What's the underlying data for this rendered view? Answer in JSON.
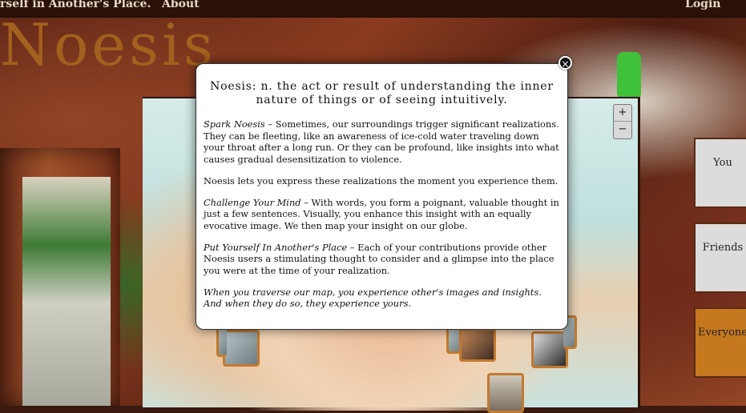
{
  "nav": {
    "tagline": "rself in Another's Place.",
    "about": "About",
    "login": "Login"
  },
  "logo": "Noesis",
  "map": {
    "zoom_in": "+",
    "zoom_out": "−"
  },
  "tabs": [
    {
      "label": "You"
    },
    {
      "label": "Friends"
    },
    {
      "label": "Everyone"
    }
  ],
  "modal": {
    "title": "Noesis: n. the act or result of understanding the inner nature of things or of seeing intuitively.",
    "p1_lead": "Spark Noesis",
    "p1_text": " – Sometimes, our surroundings trigger significant realizations. They can be fleeting, like an awareness of ice-cold water traveling down your throat after a long run. Or they can be profound, like insights into what causes gradual desensitization to violence.",
    "p2_text": "Noesis lets you express these realizations the moment you experience them.",
    "p3_lead": "Challenge Your Mind",
    "p3_text": " – With words, you form a poignant, valuable thought in just a few sentences. Visually, you enhance this insight with an equally evocative image. We then map your insight on our globe.",
    "p4_lead": "Put Yourself In Another's Place",
    "p4_text": " – Each of your contributions provide other Noesis users a stimulating thought to consider and a glimpse into the place you were at the time of your realization.",
    "p5_text": "When you traverse our map, you experience other's images and insights. And when they do so, they experience yours.",
    "close_icon": "×"
  }
}
